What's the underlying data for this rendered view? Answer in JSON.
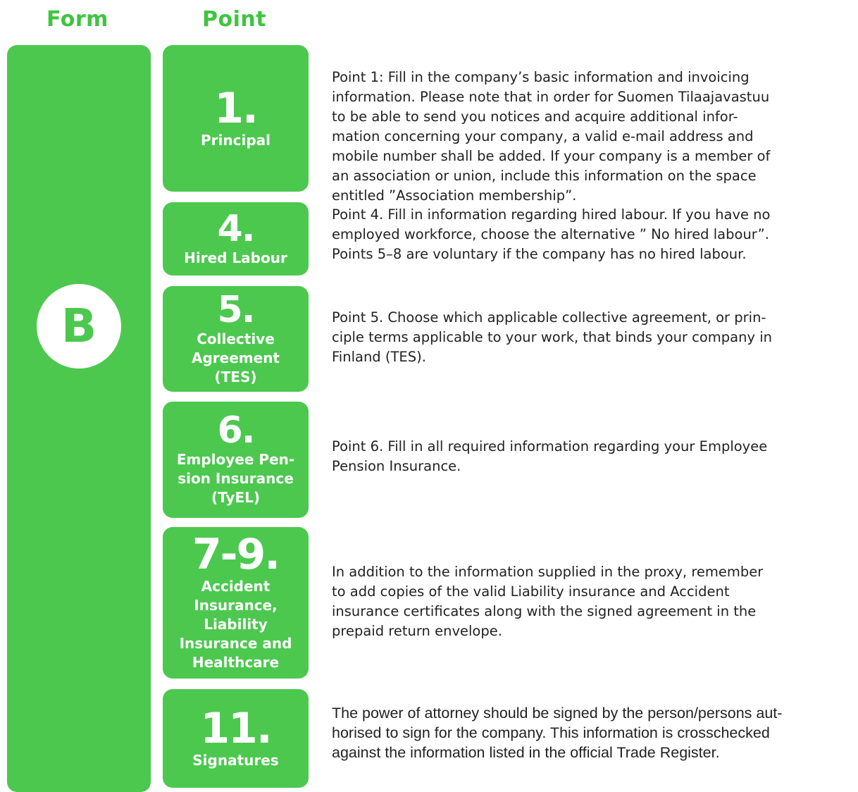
{
  "headers": {
    "form": "Form",
    "point": "Point"
  },
  "form": {
    "letter": "B"
  },
  "points": [
    {
      "number": "1.",
      "name": "Principal",
      "description_lines": [
        "Point 1: Fill in the company’s basic information and invoicing",
        "information. Please note that in order for Suomen Tilaajavastuu",
        "to be able to send you notices and acquire additional infor-",
        "mation concerning your company, a valid e-mail address and",
        "mobile number shall be added. If your company is a member of",
        "an association or union, include this information on the space",
        "entitled ”Association membership”."
      ]
    },
    {
      "number": "4.",
      "name": "Hired Labour",
      "description_lines": [
        "Point 4. Fill in information regarding hired labour. If you have no",
        "employed workforce, choose the alternative ” No hired labour”.",
        "Points 5–8 are voluntary if the company has no hired labour."
      ]
    },
    {
      "number": "5.",
      "name_lines": [
        "Collective",
        "Agreement",
        "(TES)"
      ],
      "description_lines": [
        "Point 5. Choose which applicable collective agreement, or prin-",
        "ciple terms applicable to your work, that binds your company in",
        "Finland (TES)."
      ]
    },
    {
      "number": "6.",
      "name_lines": [
        "Employee Pen-",
        "sion Insurance",
        "(TyEL)"
      ],
      "description_lines": [
        "Point 6. Fill in all required information regarding your Employee",
        "Pension Insurance."
      ]
    },
    {
      "number": "7-9.",
      "name_lines": [
        "Accident",
        "Insurance,",
        "Liability",
        "Insurance and",
        "Healthcare"
      ],
      "description_lines": [
        "In addition to the information supplied in the proxy, remember",
        "to add copies of the valid Liability insurance and Accident",
        "insurance certificates along with the signed agreement in the",
        "prepaid return envelope."
      ]
    },
    {
      "number": "11.",
      "name": "Signatures",
      "description_lines": [
        "The power of attorney should be signed by the person/persons aut-",
        "horised to sign for the company. This information is crosschecked",
        "against the information listed in the official Trade Register."
      ]
    }
  ]
}
